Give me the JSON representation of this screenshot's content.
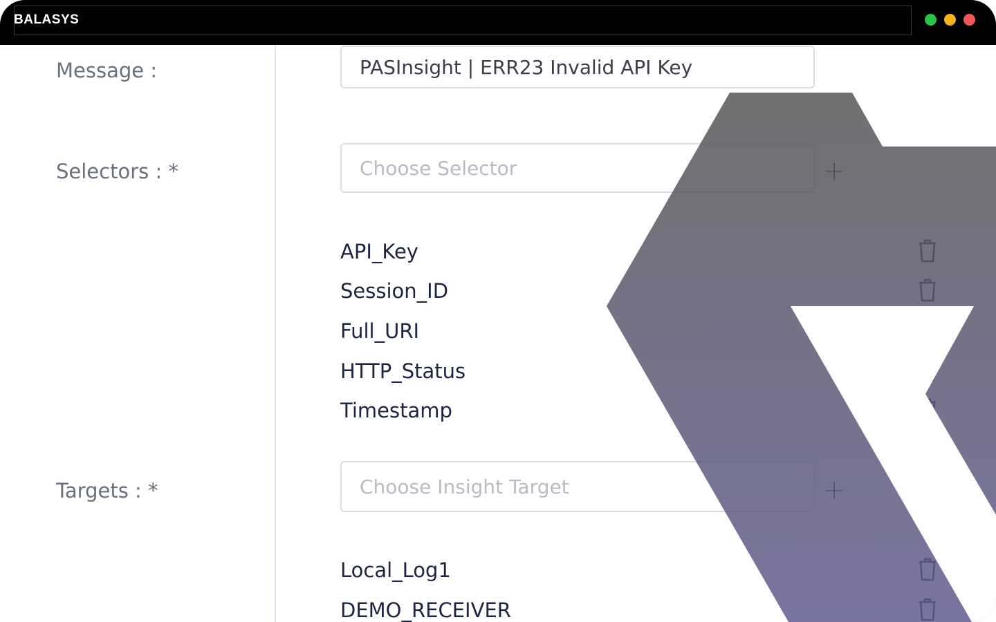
{
  "window": {
    "title": "BALASYS"
  },
  "form": {
    "message_label": "Message :",
    "message_value": "PASInsight | ERR23 Invalid API Key",
    "selectors_label": "Selectors : *",
    "selectors_placeholder": "Choose Selector",
    "selectors": [
      "API_Key",
      "Session_ID",
      "Full_URI",
      "HTTP_Status",
      "Timestamp"
    ],
    "targets_label": "Targets : *",
    "targets_placeholder": "Choose Insight Target",
    "targets": [
      "Local_Log1",
      "DEMO_RECEIVER"
    ]
  },
  "colors": {
    "titlebar": "#000000",
    "window_dot_green": "#2bc44a",
    "window_dot_yellow": "#f5b21b",
    "window_dot_red": "#f2555a",
    "watermark_top": "#555555",
    "watermark_bottom": "#5f5a8e"
  },
  "icons": {
    "add": "plus-icon",
    "delete": "trash-icon"
  }
}
